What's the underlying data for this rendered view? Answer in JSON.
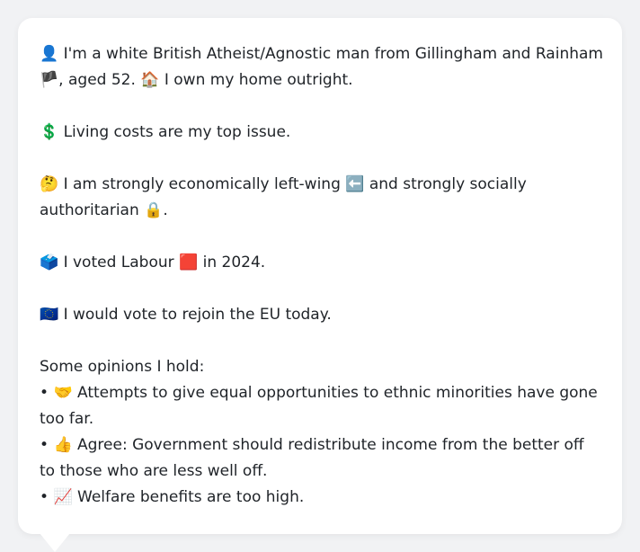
{
  "bio": {
    "line1_icon": "👤",
    "line1_text": " I'm a white British Atheist/Agnostic man from Gillingham and Rainham ",
    "flag_icon": "🏴",
    "line1_text2": ", aged 52. ",
    "home_icon": "🏠",
    "line1_text3": " I own my home outright."
  },
  "issue": {
    "icon": "💲",
    "text": " Living costs are my top issue."
  },
  "ideology": {
    "icon": "🤔",
    "text1": " I am strongly economically left-wing ",
    "left_icon": "⬅️",
    "text2": " and strongly socially authoritarian ",
    "lock_icon": "🔒",
    "text3": "."
  },
  "vote": {
    "icon": "🗳️",
    "text1": " I voted Labour ",
    "party_icon": "🟥",
    "text2": " in 2024."
  },
  "eu": {
    "icon": "🇪🇺",
    "text": " I would vote to rejoin the EU today."
  },
  "opinions": {
    "heading": "Some opinions I hold:",
    "items": [
      {
        "bullet": "• ",
        "icon": "🤝",
        "text": " Attempts to give equal opportunities to ethnic minorities have gone too far."
      },
      {
        "bullet": "• ",
        "icon": "👍",
        "text": " Agree: Government should redistribute income from the better off to those who are less well off."
      },
      {
        "bullet": "• ",
        "icon": "📈",
        "text": " Welfare benefits are too high."
      }
    ]
  }
}
